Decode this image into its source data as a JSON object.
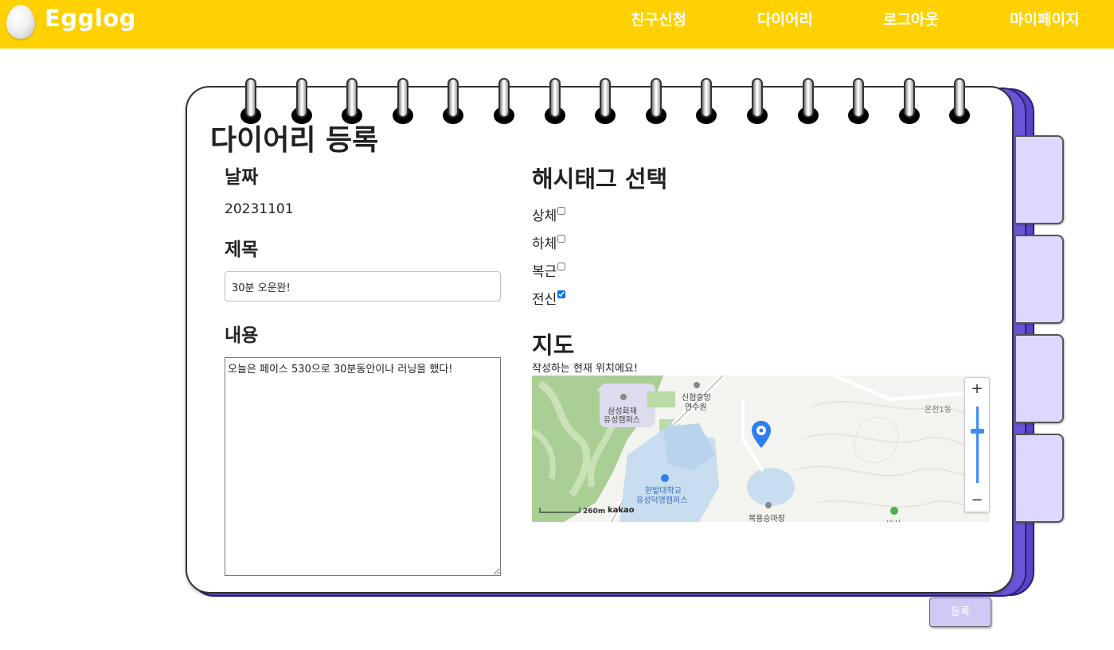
{
  "header": {
    "logo_text": "Egglog",
    "nav": [
      {
        "label": "친구신청"
      },
      {
        "label": "다이어리"
      },
      {
        "label": "로그아웃"
      },
      {
        "label": "마이페이지"
      }
    ]
  },
  "diary": {
    "page_title": "다이어리 등록",
    "date_label": "날짜",
    "date_value": "20231101",
    "title_label": "제목",
    "title_value": "30분 오운완!",
    "content_label": "내용",
    "content_value": "오늘은 페이스 530으로 30분동안이나 러닝을 했다!",
    "hashtag_label": "해시태그 선택",
    "tags": [
      {
        "label": "상체",
        "checked": false
      },
      {
        "label": "하체",
        "checked": false
      },
      {
        "label": "복근",
        "checked": false
      },
      {
        "label": "전신",
        "checked": true
      }
    ],
    "map_label": "지도",
    "map_caption": "작성하는 현재 위치에요!",
    "submit_label": "등록"
  },
  "map": {
    "places": [
      {
        "name": "신협중앙"
      },
      {
        "name": "연수원"
      },
      {
        "name": "삼성화재"
      },
      {
        "name": "유성캠퍼스"
      },
      {
        "name": "한밭대학교"
      },
      {
        "name": "유성덕명캠퍼스"
      },
      {
        "name": "온천1동"
      },
      {
        "name": "복용승마장"
      },
      {
        "name": "바산"
      }
    ],
    "scale_label": "260m",
    "brand": "kakao",
    "zoom_in": "+",
    "zoom_out": "−",
    "colors": {
      "park": "#a9cf94",
      "water": "#c9ddf0",
      "marker": "#2f7ff3"
    }
  },
  "colors": {
    "header": "#ffd100",
    "notebook_back": "#5a43c7",
    "tab": "#dcd8ff",
    "button": "#cfcaf5"
  }
}
